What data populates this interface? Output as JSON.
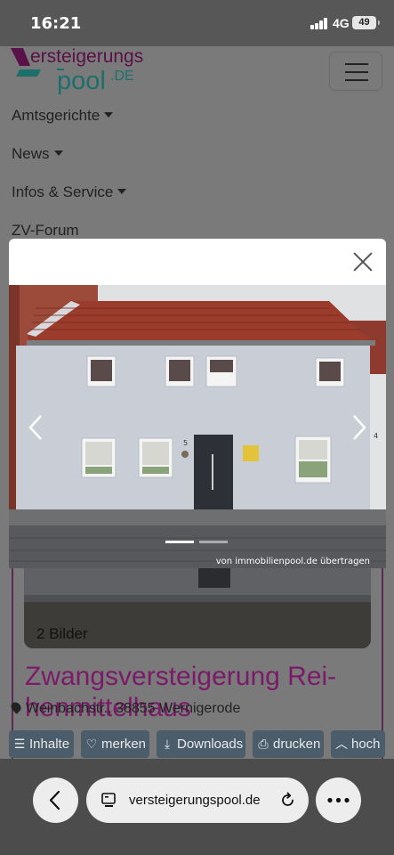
{
  "status_bar": {
    "time": "16:21",
    "network": "4G",
    "battery": "49"
  },
  "site": {
    "logo_text_line1": "ersteigerungs",
    "logo_text_line2": "pool",
    "logo_text_suffix": ".DE",
    "nav": [
      {
        "label": "Amtsgerichte",
        "has_dropdown": true
      },
      {
        "label": "News",
        "has_dropdown": true
      },
      {
        "label": "Infos & Service",
        "has_dropdown": true
      },
      {
        "label": "ZV-Forum",
        "has_dropdown": false
      }
    ]
  },
  "listing": {
    "image_count": "2 Bilder",
    "title": "Zwangsversteigerung Rei-henmittelhaus",
    "address_partial": "Weinbachstr., 38855 Wernigerode"
  },
  "actions": [
    {
      "label": "Inhalte",
      "icon": "list-icon"
    },
    {
      "label": "merken",
      "icon": "heart-icon"
    },
    {
      "label": "Downloads",
      "icon": "download-icon"
    },
    {
      "label": "drucken",
      "icon": "printer-icon"
    },
    {
      "label": "hoch",
      "icon": "chevron-up-icon"
    }
  ],
  "modal": {
    "caption": "von immobilienpool.de übertragen",
    "current_slide": 1,
    "total_slides": 2,
    "house_number": "5"
  },
  "browser": {
    "url": "versteigerungspool.de"
  },
  "colors": {
    "brand_purple": "#7c1a6a",
    "brand_teal": "#1f8a86",
    "action_bar": "#4b5d6b"
  }
}
